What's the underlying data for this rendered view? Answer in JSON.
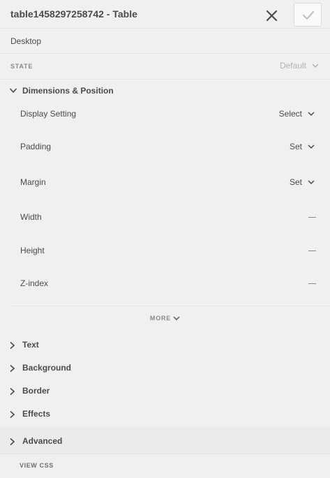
{
  "header": {
    "title": "table1458297258742 - Table"
  },
  "breakpoint": {
    "label": "Desktop"
  },
  "state": {
    "label": "STATE",
    "value": "Default"
  },
  "dimensions": {
    "label": "Dimensions & Position",
    "expanded": true,
    "rows": [
      {
        "label": "Display Setting",
        "value": "Select"
      },
      {
        "label": "Padding",
        "value": "Set"
      },
      {
        "label": "Margin",
        "value": "Set"
      },
      {
        "label": "Width",
        "value": "—"
      },
      {
        "label": "Height",
        "value": "—"
      },
      {
        "label": "Z-index",
        "value": "—"
      }
    ],
    "more_label": "MORE"
  },
  "sections": [
    {
      "label": "Text"
    },
    {
      "label": "Background"
    },
    {
      "label": "Border"
    },
    {
      "label": "Effects"
    },
    {
      "label": "Advanced"
    }
  ],
  "footer": {
    "view_css_label": "VIEW CSS"
  },
  "icons": {
    "close": "close-icon",
    "done": "checkmark-icon",
    "chevron_down": "chevron-down-icon",
    "chevron_right": "chevron-right-icon"
  },
  "colors": {
    "background": "#f0f0f0",
    "text": "#4b4b4b",
    "muted": "#8a8a8a",
    "disabled": "#b3b3b3",
    "divider": "#e3e3e3"
  }
}
